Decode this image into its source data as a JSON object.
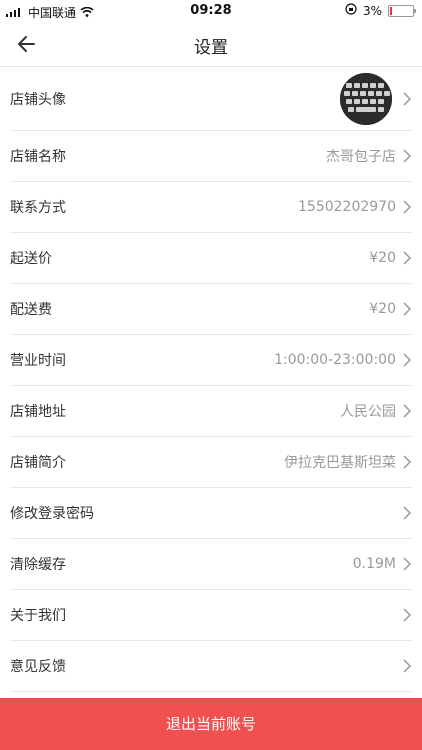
{
  "status_bar": {
    "carrier": "中国联通",
    "time": "09:28",
    "battery": "3%"
  },
  "header": {
    "title": "设置",
    "back_icon": "arrow-left-icon"
  },
  "settings": {
    "items": [
      {
        "label": "店铺头像",
        "value": ""
      },
      {
        "label": "店铺名称",
        "value": "杰哥包子店"
      },
      {
        "label": "联系方式",
        "value": "15502202970"
      },
      {
        "label": "起送价",
        "value": "¥20"
      },
      {
        "label": "配送费",
        "value": "¥20"
      },
      {
        "label": "营业时间",
        "value": "1:00:00-23:00:00"
      },
      {
        "label": "店铺地址",
        "value": "人民公园"
      },
      {
        "label": "店铺简介",
        "value": "伊拉克巴基斯坦菜"
      },
      {
        "label": "修改登录密码",
        "value": ""
      },
      {
        "label": "清除缓存",
        "value": "0.19M"
      },
      {
        "label": "关于我们",
        "value": ""
      },
      {
        "label": "意见反馈",
        "value": ""
      }
    ]
  },
  "footer": {
    "logout_label": "退出当前账号"
  },
  "colors": {
    "accent": "#f05050",
    "value_text": "#999999"
  }
}
